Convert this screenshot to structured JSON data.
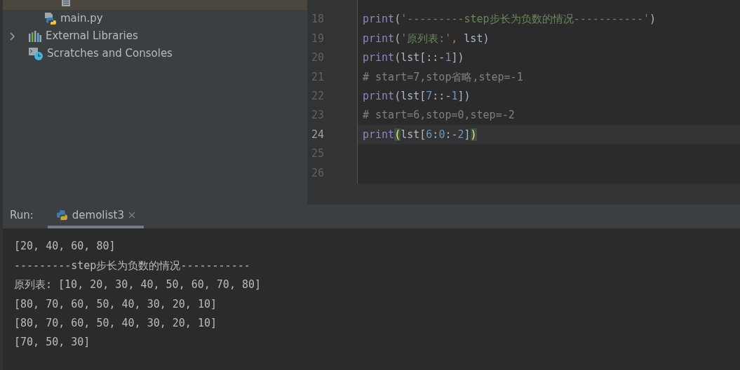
{
  "project_tree": [
    {
      "selected": true
    },
    {
      "label": "main.py",
      "selected": false
    },
    {
      "label": "External Libraries",
      "selected": false,
      "expanded": false
    },
    {
      "label": "Scratches and Consoles",
      "selected": false
    }
  ],
  "editor": {
    "lines": [
      {
        "number": "18",
        "current": false,
        "tokens": [
          {
            "text": "print",
            "kind": "builtin"
          },
          {
            "text": "(",
            "kind": "plain"
          },
          {
            "text": "'---------step步长为负数的情况-----------'",
            "kind": "string"
          },
          {
            "text": ")",
            "kind": "plain"
          }
        ]
      },
      {
        "number": "19",
        "current": false,
        "tokens": [
          {
            "text": "print",
            "kind": "builtin"
          },
          {
            "text": "(",
            "kind": "plain"
          },
          {
            "text": "'原列表:'",
            "kind": "string"
          },
          {
            "text": ",",
            "kind": "punct"
          },
          {
            "text": " lst)",
            "kind": "plain"
          }
        ]
      },
      {
        "number": "20",
        "current": false,
        "tokens": [
          {
            "text": "print",
            "kind": "builtin"
          },
          {
            "text": "(lst[::-",
            "kind": "plain"
          },
          {
            "text": "1",
            "kind": "number"
          },
          {
            "text": "])",
            "kind": "plain"
          }
        ]
      },
      {
        "number": "21",
        "current": false,
        "tokens": [
          {
            "text": "# start=7,stop省略,step=-1",
            "kind": "comment"
          }
        ]
      },
      {
        "number": "22",
        "current": false,
        "tokens": [
          {
            "text": "print",
            "kind": "builtin"
          },
          {
            "text": "(lst[",
            "kind": "plain"
          },
          {
            "text": "7",
            "kind": "number"
          },
          {
            "text": "::-",
            "kind": "plain"
          },
          {
            "text": "1",
            "kind": "number"
          },
          {
            "text": "])",
            "kind": "plain"
          }
        ]
      },
      {
        "number": "23",
        "current": false,
        "tokens": [
          {
            "text": "# start=6,stop=0,step=-2",
            "kind": "comment"
          }
        ]
      },
      {
        "number": "24",
        "current": true,
        "tokens": [
          {
            "text": "print",
            "kind": "builtin"
          },
          {
            "text": "(",
            "kind": "brace-match"
          },
          {
            "text": "lst[",
            "kind": "plain"
          },
          {
            "text": "6",
            "kind": "number"
          },
          {
            "text": ":",
            "kind": "plain"
          },
          {
            "text": "0",
            "kind": "number"
          },
          {
            "text": ":-",
            "kind": "plain"
          },
          {
            "text": "2",
            "kind": "number"
          },
          {
            "text": "]",
            "kind": "plain"
          },
          {
            "text": ")",
            "kind": "brace-match"
          }
        ]
      },
      {
        "number": "25",
        "current": false
      },
      {
        "number": "26",
        "current": false
      }
    ]
  },
  "run_panel": {
    "label": "Run:",
    "tabs": [
      {
        "title": "demolist3",
        "selected": true
      }
    ],
    "output": [
      "[20, 40, 60, 80]",
      "---------step步长为负数的情况-----------",
      "原列表: [10, 20, 30, 40, 50, 60, 70, 80]",
      "[80, 70, 60, 50, 40, 30, 20, 10]",
      "[80, 70, 60, 50, 40, 30, 20, 10]",
      "[70, 50, 30]"
    ]
  }
}
